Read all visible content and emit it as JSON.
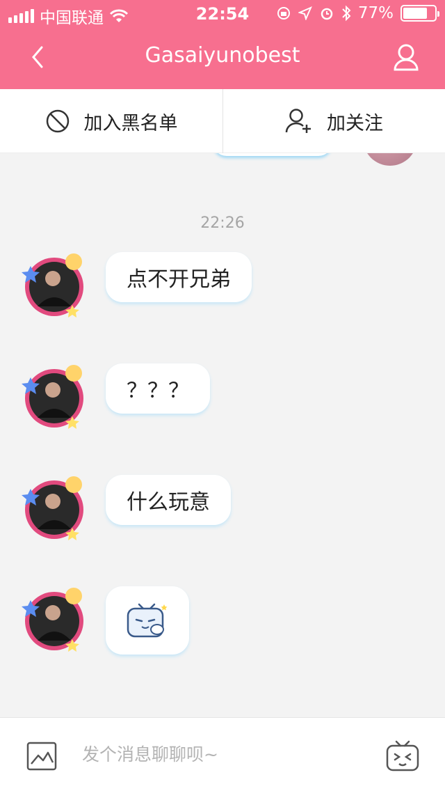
{
  "status_bar": {
    "carrier": "中国联通",
    "time": "22:54",
    "battery_text": "77%",
    "battery_level": 0.77
  },
  "nav": {
    "title": "Gasaiyunobest"
  },
  "actions": {
    "blacklist_label": "加入黑名单",
    "follow_label": "加关注"
  },
  "chat": {
    "timestamp": "22:26",
    "messages": [
      {
        "type": "text",
        "text": "点不开兄弟"
      },
      {
        "type": "text",
        "text": "？？？"
      },
      {
        "type": "text",
        "text": "什么玩意"
      },
      {
        "type": "sticker",
        "sticker": "blushing-tv-mascot"
      }
    ]
  },
  "input": {
    "placeholder": "发个消息聊聊呗~"
  },
  "colors": {
    "brand": "#f76f8f",
    "bubble_shadow": "#c9e7f7",
    "page_bg": "#f3f3f3"
  }
}
